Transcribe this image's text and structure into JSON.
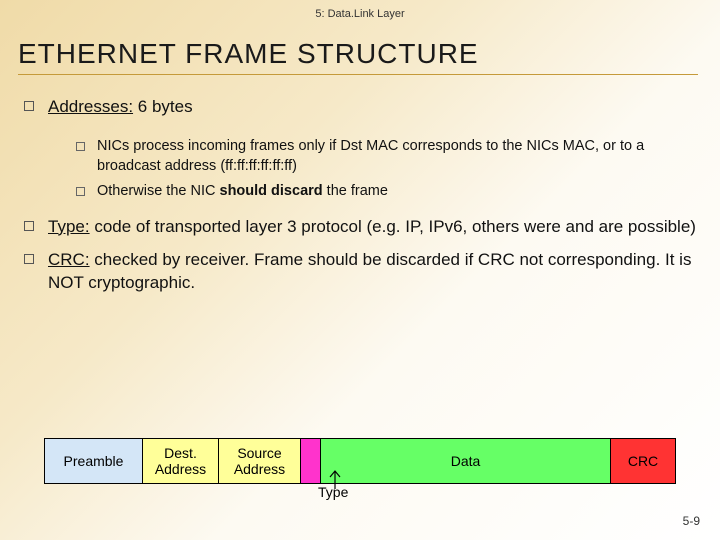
{
  "chapter": "5: Data.Link Layer",
  "title": "ETHERNET FRAME STRUCTURE",
  "bullets": {
    "addr_prefix": "Addresses:",
    "addr_suffix": " 6 bytes",
    "sub1": "NICs process incoming frames only if Dst MAC corresponds to the NICs MAC, or to a broadcast address (ff:ff:ff:ff:ff:ff)",
    "sub2_a": "Otherwise the NIC ",
    "sub2_b": "should discard",
    "sub2_c": " the frame",
    "type_prefix": "Type:",
    "type_body": " code of transported layer 3 protocol (e.g. IP, IPv6, others were and are possible)",
    "crc_prefix": "CRC:",
    "crc_body": " checked by receiver. Frame should be discarded if CRC not corresponding. It is NOT cryptographic."
  },
  "frame": {
    "preamble": "Preamble",
    "dest": "Dest. Address",
    "src": "Source Address",
    "data": "Data",
    "crc": "CRC",
    "type_label": "Type"
  },
  "page": "5-9"
}
